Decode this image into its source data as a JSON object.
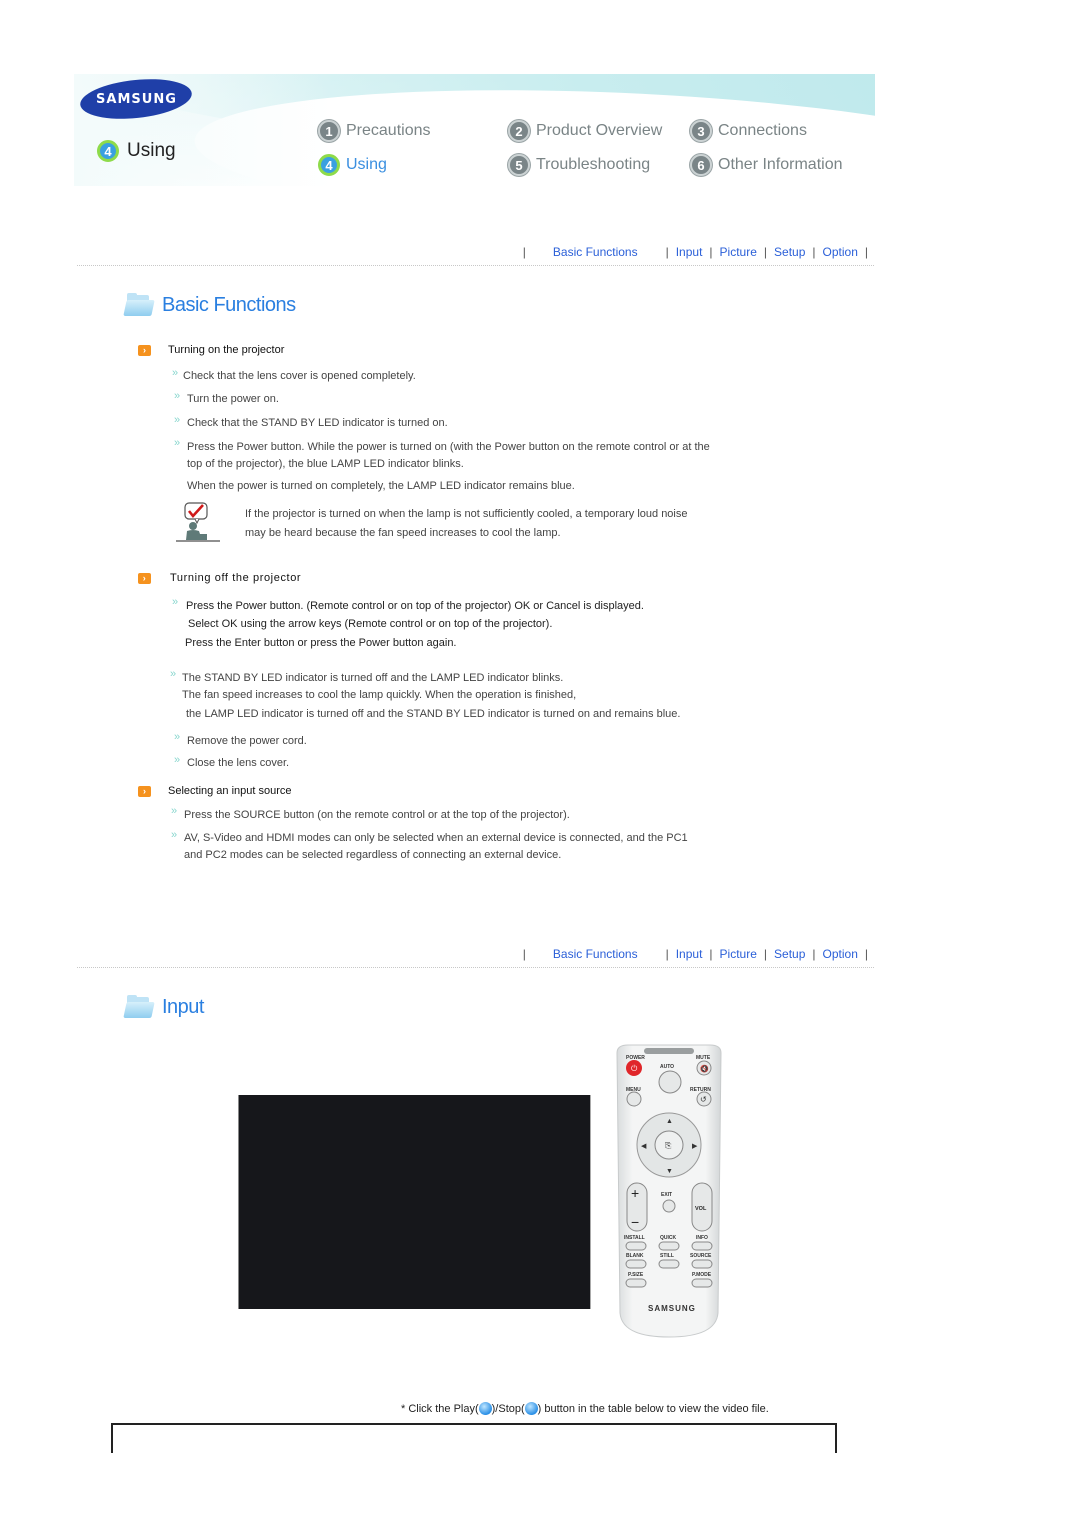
{
  "header": {
    "brand": "SAMSUNG",
    "current_section": {
      "number": "4",
      "label": "Using"
    },
    "nav": [
      {
        "number": "1",
        "label": "Precautions",
        "active": false
      },
      {
        "number": "2",
        "label": "Product Overview",
        "active": false
      },
      {
        "number": "3",
        "label": "Connections",
        "active": false
      },
      {
        "number": "4",
        "label": "Using",
        "active": true
      },
      {
        "number": "5",
        "label": "Troubleshooting",
        "active": false
      },
      {
        "number": "6",
        "label": "Other Information",
        "active": false
      }
    ]
  },
  "subnav": {
    "items": [
      "Basic Functions",
      "Input",
      "Picture",
      "Setup",
      "Option"
    ],
    "separator": "|"
  },
  "basic_functions": {
    "title": "Basic Functions",
    "turning_on": {
      "heading": "Turning on the projector",
      "steps": [
        "Check that the lens cover is opened completely.",
        "Turn the power on.",
        "Check that the STAND BY LED indicator is turned on.",
        "Press the Power button. While the power is turned on (with the Power button on the remote control or at the",
        "top of the projector), the blue LAMP LED indicator blinks.",
        "When the power is turned on completely, the LAMP LED indicator remains blue."
      ],
      "note_lines": [
        "If the projector is turned on when the lamp is not sufficiently cooled, a temporary loud noise",
        "may be heard because the fan speed increases to cool the lamp."
      ]
    },
    "turning_off": {
      "heading": "Turning off the projector",
      "steps": [
        "Press the Power button. (Remote control or on top of the projector) OK or Cancel is displayed.",
        "Select OK using the arrow keys (Remote control or on top of the projector).",
        "Press the Enter button or press the Power button again.",
        "The STAND BY LED indicator is turned off and the LAMP LED indicator blinks.",
        "The fan speed increases to cool the lamp quickly. When the operation is finished,",
        "the LAMP LED indicator is turned off and the STAND BY LED indicator is turned on and remains blue.",
        "Remove the power cord.",
        "Close the lens cover."
      ]
    },
    "input_source": {
      "heading": "Selecting an input source",
      "steps": [
        "Press the SOURCE button (on the remote control or at the top of the projector).",
        "AV, S-Video and HDMI modes can only be selected when an external device is connected, and the PC1",
        "and PC2 modes can be selected regardless of connecting an external device."
      ]
    }
  },
  "input": {
    "title": "Input",
    "remote": {
      "labels": {
        "power": "POWER",
        "mute": "MUTE",
        "auto": "AUTO",
        "menu": "MENU",
        "return": "RETURN",
        "exit": "EXIT",
        "vol": "VOL",
        "install": "INSTALL",
        "quick": "QUICK",
        "info": "INFO",
        "blank": "BLANK",
        "still": "STILL",
        "source": "SOURCE",
        "psize": "P.SIZE",
        "pmode": "P.MODE",
        "brand": "SAMSUNG"
      }
    },
    "caption": {
      "prefix": "* Click the Play(",
      "middle": ")/Stop(",
      "suffix": ") button in the table below to view the video file."
    }
  },
  "colors": {
    "link": "#2a5fd8",
    "accent_orange": "#f5921e",
    "heading_blue": "#2a7fe0"
  }
}
